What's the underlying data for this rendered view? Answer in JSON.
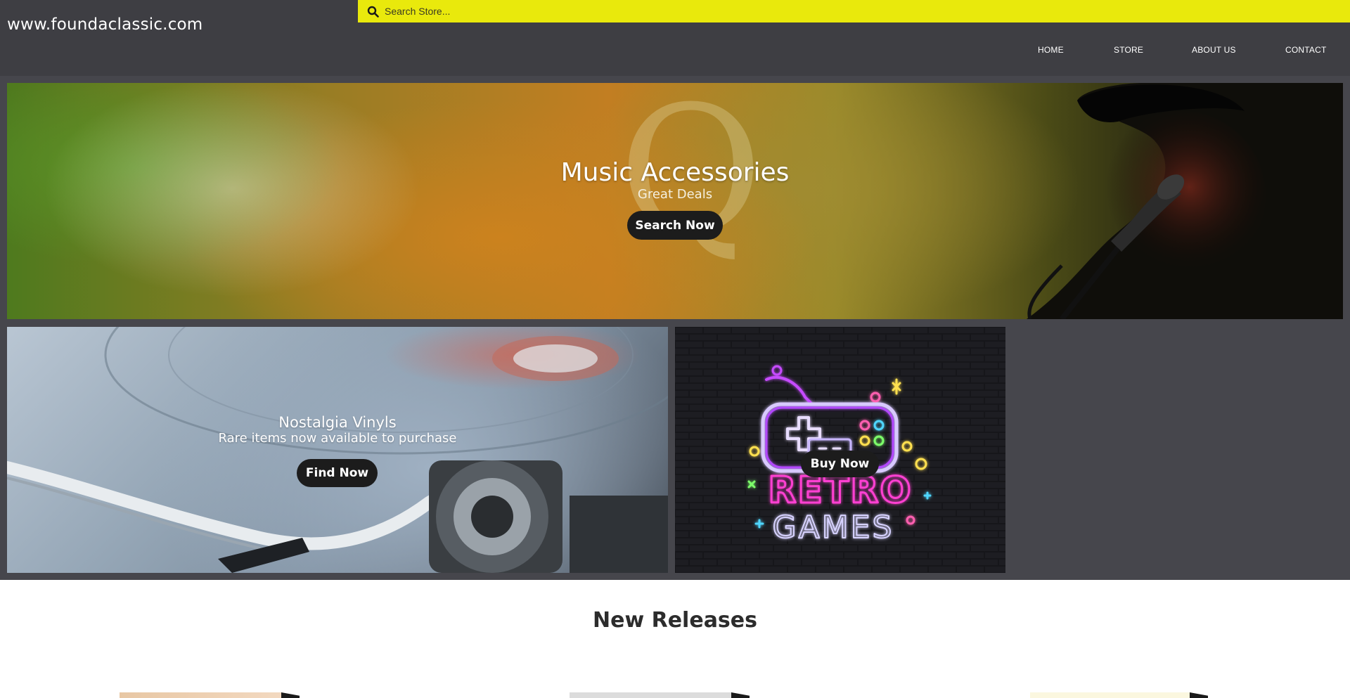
{
  "header": {
    "site_title": "www.foundaclassic.com",
    "search": {
      "placeholder": "Search Store...",
      "value": "",
      "icon": "search-icon"
    },
    "nav": {
      "home": "HOME",
      "store": "STORE",
      "about": "ABOUT US",
      "contact": "CONTACT"
    }
  },
  "hero": {
    "title": "Music Accessories",
    "subtitle": "Great Deals",
    "button_label": "Search Now"
  },
  "promos": [
    {
      "title": "Nostalgia Vinyls",
      "subtitle": "Rare items now available to purchase",
      "button_label": "Find Now"
    },
    {
      "button_label": "Buy Now",
      "sign_line1": "RETRO",
      "sign_line2": "GAMES"
    }
  ],
  "releases": {
    "title": "New Releases"
  },
  "colors": {
    "header_bg": "#3e3e43",
    "search_bar": "#e9e90c",
    "promo_bg": "#46464c",
    "button_bg": "#1c1c1c"
  }
}
